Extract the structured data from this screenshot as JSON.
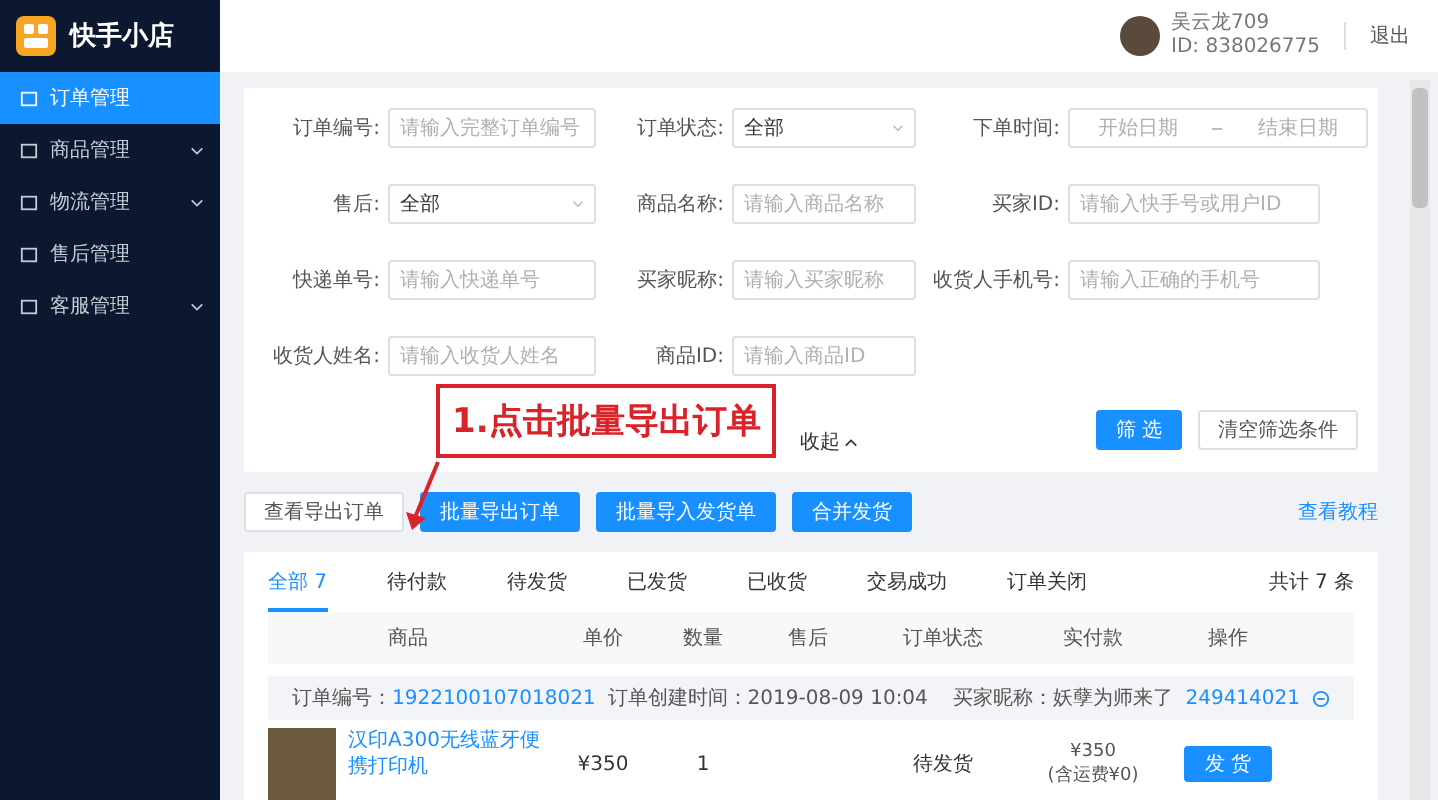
{
  "sidebar": {
    "app_name": "快手小店",
    "items": [
      {
        "label": "订单管理",
        "selected": true,
        "expandable": false
      },
      {
        "label": "商品管理",
        "selected": false,
        "expandable": true
      },
      {
        "label": "物流管理",
        "selected": false,
        "expandable": true
      },
      {
        "label": "售后管理",
        "selected": false,
        "expandable": false
      },
      {
        "label": "客服管理",
        "selected": false,
        "expandable": true
      }
    ]
  },
  "header": {
    "user_name": "吴云龙709",
    "user_id": "ID: 838026775",
    "logout": "退出"
  },
  "filters": [
    {
      "label": "订单编号:",
      "kind": "input",
      "placeholder": "请输入完整订单编号"
    },
    {
      "label": "订单状态:",
      "kind": "select",
      "value": "全部"
    },
    {
      "label": "下单时间:",
      "kind": "daterange",
      "placeholder": "开始日期",
      "placeholder_end": "结束日期"
    },
    {
      "label": "售后:",
      "kind": "select",
      "value": "全部"
    },
    {
      "label": "商品名称:",
      "kind": "input",
      "placeholder": "请输入商品名称"
    },
    {
      "label": "买家ID:",
      "kind": "input",
      "placeholder": "请输入快手号或用户ID"
    },
    {
      "label": "快递单号:",
      "kind": "input",
      "placeholder": "请输入快递单号"
    },
    {
      "label": "买家昵称:",
      "kind": "input",
      "placeholder": "请输入买家昵称"
    },
    {
      "label": "收货人手机号:",
      "kind": "input",
      "placeholder": "请输入正确的手机号"
    },
    {
      "label": "收货人姓名:",
      "kind": "input",
      "placeholder": "请输入收货人姓名"
    },
    {
      "label": "商品ID:",
      "kind": "input",
      "placeholder": "请输入商品ID"
    }
  ],
  "collapse_link": "收起",
  "filter_buttons": {
    "apply": "筛 选",
    "clear": "清空筛选条件"
  },
  "annotation": "1.点击批量导出订单",
  "actions": [
    {
      "label": "查看导出订单",
      "kind": "plain"
    },
    {
      "label": "批量导出订单",
      "kind": "primary"
    },
    {
      "label": "批量导入发货单",
      "kind": "primary"
    },
    {
      "label": "合并发货",
      "kind": "primary"
    }
  ],
  "tutorial_link": "查看教程",
  "tabs": [
    {
      "label": "全部 7",
      "selected": true
    },
    {
      "label": "待付款",
      "selected": false
    },
    {
      "label": "待发货",
      "selected": false
    },
    {
      "label": "已发货",
      "selected": false
    },
    {
      "label": "已收货",
      "selected": false
    },
    {
      "label": "交易成功",
      "selected": false
    },
    {
      "label": "订单关闭",
      "selected": false
    }
  ],
  "total": "共计 7 条",
  "table": {
    "columns": [
      "商品",
      "单价",
      "数量",
      "售后",
      "订单状态",
      "实付款",
      "操作"
    ],
    "order": {
      "number_label": "订单编号：",
      "number": "1922100107018021",
      "created": "订单创建时间：2019-08-09 10:04",
      "buyer": "买家昵称：妖孽为师来了",
      "buyer_id": "249414021",
      "product": "汉印A300无线蓝牙便携打印机",
      "price": "¥350",
      "quantity": "1",
      "status": "待发货",
      "paid": "¥350",
      "shipping": "(含运费¥0)",
      "ship_button": "发 货"
    }
  }
}
